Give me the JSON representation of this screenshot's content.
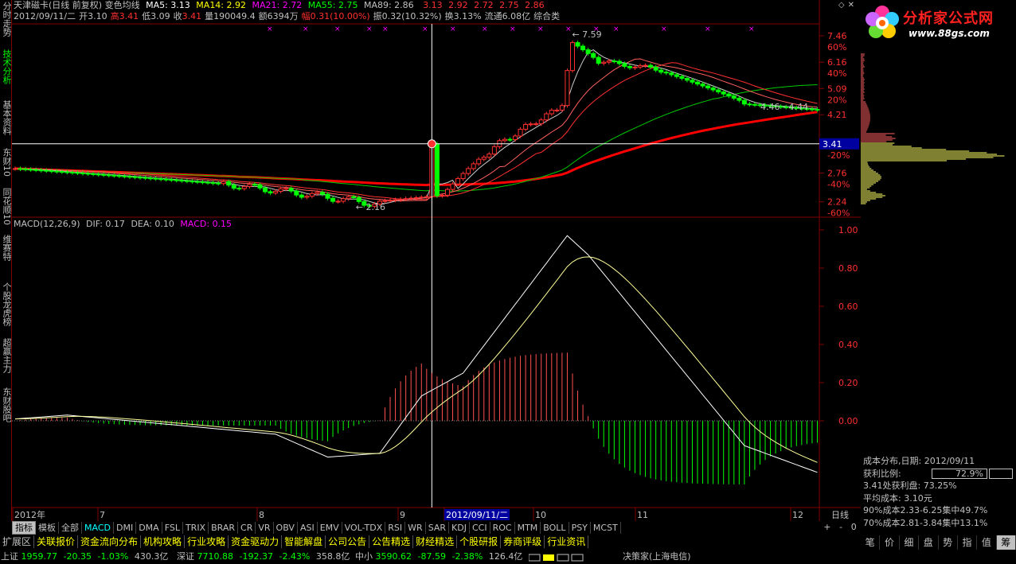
{
  "side_tabs": [
    {
      "label": "分时走势",
      "active": false
    },
    {
      "label": "技术分析",
      "active": true
    },
    {
      "label": "基本资料",
      "active": false
    },
    {
      "label": "东财10",
      "active": false
    },
    {
      "label": "同花顺10",
      "active": false
    },
    {
      "label": "维赛特",
      "active": false
    },
    {
      "label": "个股龙虎榜",
      "active": false
    },
    {
      "label": "超赢主力",
      "active": false
    },
    {
      "label": "东财股吧",
      "active": false
    }
  ],
  "header": {
    "stock_name": "天津磁卡(日线 前复权) 变色均线",
    "ma5": "MA5: 3.13",
    "ma14": "MA14: 2.92",
    "ma21": "MA21: 2.72",
    "ma55": "MA55: 2.75",
    "ma89": "MA89: 2.86",
    "extra1": "3.13",
    "extra2": "2.92",
    "extra3": "2.72",
    "extra4": "2.75",
    "extra5": "2.86",
    "date": "2012/09/11/二",
    "open_label": "开",
    "open_val": "3.10",
    "high_label": "高",
    "high_val": "3.41",
    "low_label": "低",
    "low_val": "3.09",
    "close_label": "收",
    "close_val": "3.41",
    "vol_label": "量",
    "vol_val": "190049.4",
    "amt_label": "额",
    "amt_val": "6394万",
    "pct_label": "幅",
    "pct_val": "0.31(10.00%)",
    "amp_label": "振",
    "amp_val": "0.32(10.32%)",
    "turn_label": "换",
    "turn_val": "3.13%",
    "float_label": "流通",
    "float_val": "6.08亿",
    "sector": "综合类"
  },
  "price_labels": {
    "high_mark": "7.59",
    "low_mark": "2.16",
    "right_mark": "4.46 - 4.44",
    "cursor_price": "3.41"
  },
  "price_axis": [
    {
      "v": "7.46",
      "p": "60%"
    },
    {
      "v": "6.16",
      "p": "40%"
    },
    {
      "v": "5.09",
      "p": "20%"
    },
    {
      "v": "4.21",
      "p": ""
    },
    {
      "v": "3.41",
      "p": "-20%"
    },
    {
      "v": "2.76",
      "p": "-40%"
    },
    {
      "v": "2.24",
      "p": "-60%"
    }
  ],
  "macd": {
    "title": "MACD(12,26,9)",
    "dif": "DIF: 0.17",
    "dea": "DEA: 0.10",
    "macd": "MACD: 0.15",
    "axis": [
      "1.00",
      "0.80",
      "0.60",
      "0.40",
      "0.20",
      "0.00"
    ]
  },
  "date_axis": {
    "labels": [
      "2012年",
      "7",
      "8",
      "9",
      "2012/09/11/二",
      "10",
      "11",
      "12"
    ],
    "right_label": "日线"
  },
  "zoom": [
    "+",
    "-",
    "0"
  ],
  "indicators": [
    "指标",
    "模板",
    "全部",
    "MACD",
    "DMI",
    "DMA",
    "FSL",
    "TRIX",
    "BRAR",
    "CR",
    "VR",
    "OBV",
    "ASI",
    "EMV",
    "VOL-TDX",
    "RSI",
    "WR",
    "SAR",
    "KDJ",
    "CCI",
    "ROC",
    "MTM",
    "BOLL",
    "PSY",
    "MCST"
  ],
  "function_tabs": [
    "扩展区",
    "关联报价",
    "资金流向分布",
    "机构攻略",
    "行业攻略",
    "资金驱动力",
    "智能解盘",
    "公司公告",
    "公告精选",
    "财经精选",
    "个股研报",
    "券商评级",
    "行业资讯"
  ],
  "status": {
    "sh_label": "上证",
    "sh_val": "1959.77",
    "sh_chg": "-20.35",
    "sh_pct": "-1.03%",
    "sh_amt": "430.3亿",
    "sz_label": "深证",
    "sz_val": "7710.88",
    "sz_chg": "-192.37",
    "sz_pct": "-2.43%",
    "sz_amt": "358.8亿",
    "zx_label": "中小",
    "zx_val": "3590.62",
    "zx_chg": "-87.59",
    "zx_pct": "-2.38%",
    "zx_amt": "126.4亿",
    "broker": "决策家(上海电信)"
  },
  "logo": {
    "title": "分析家公式网",
    "url": "www.88gs.com"
  },
  "cost_info": {
    "date_line": "成本分布,日期: 2012/09/11",
    "profit_label": "获利比例:",
    "profit_val": "72.9%",
    "at_price": "3.41处获利盘: 73.25%",
    "avg_cost": "平均成本: 3.10元",
    "c90": "90%成本2.33-6.25集中49.7%",
    "c70": "70%成本2.81-3.84集中13.1%"
  },
  "bottom_tabs": [
    {
      "label": "笔",
      "active": false
    },
    {
      "label": "价",
      "active": false
    },
    {
      "label": "细",
      "active": false
    },
    {
      "label": "盘",
      "active": false
    },
    {
      "label": "势",
      "active": false
    },
    {
      "label": "指",
      "active": false
    },
    {
      "label": "值",
      "active": false
    },
    {
      "label": "筹",
      "active": true
    }
  ],
  "colors": {
    "up": "#ff3030",
    "down": "#00ff00",
    "ma5": "#ffffff",
    "ma_red": "#ff0000",
    "grid": "#800000",
    "cursor": "#ffffff"
  }
}
